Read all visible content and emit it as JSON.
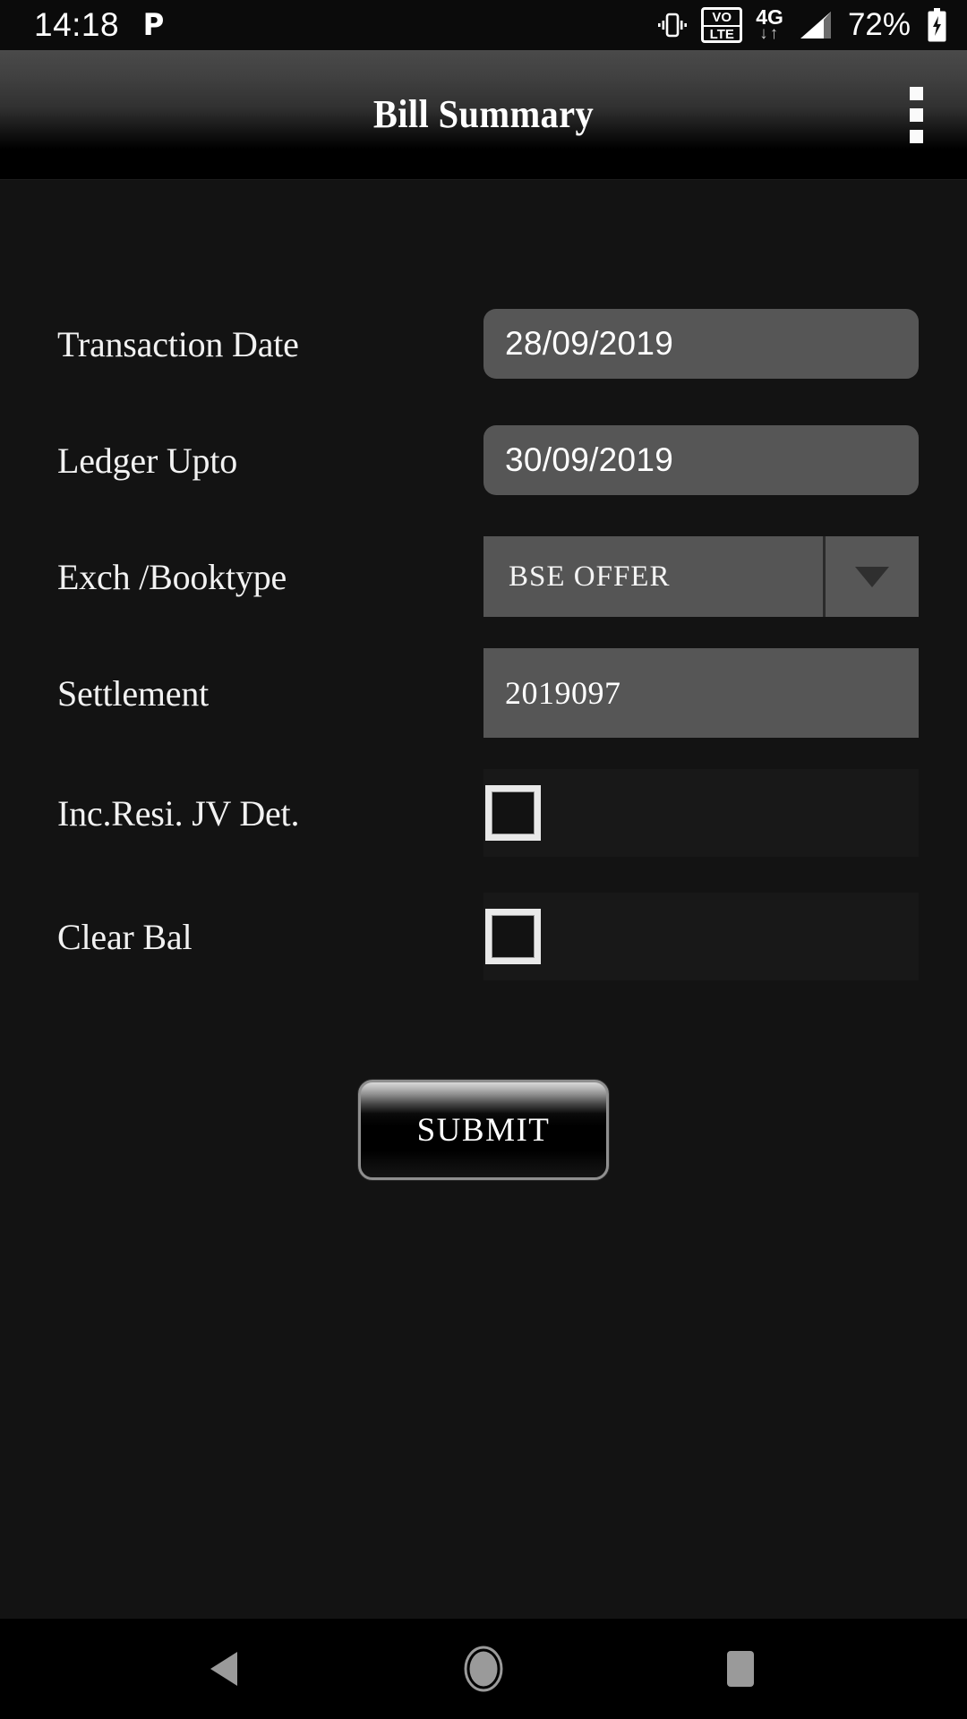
{
  "status_bar": {
    "clock": "14:18",
    "app_icon": "P",
    "icons": [
      "vibrate-icon",
      "volte-icon",
      "4g-icon",
      "signal-icon",
      "battery-charging-icon"
    ],
    "volte_top": "VO",
    "volte_bottom": "LTE",
    "network": "4G",
    "network_arrows": "↓↑",
    "battery_percent": "72%"
  },
  "app_bar": {
    "title": "Bill Summary",
    "overflow_label": "More options"
  },
  "form": {
    "rows": [
      {
        "label": "Transaction Date",
        "value": "28/09/2019",
        "type": "date"
      },
      {
        "label": "Ledger Upto",
        "value": "30/09/2019",
        "type": "date"
      },
      {
        "label": "Exch /Booktype",
        "value": "BSE  OFFER",
        "type": "spinner"
      },
      {
        "label": "Settlement",
        "value": "2019097",
        "type": "text"
      },
      {
        "label": "Inc.Resi. JV Det.",
        "value": "",
        "type": "checkbox",
        "checked": false
      },
      {
        "label": "Clear Bal",
        "value": "",
        "type": "checkbox",
        "checked": false
      }
    ]
  },
  "submit": {
    "label": "SUBMIT"
  },
  "nav_bar": {
    "back": "back-icon",
    "home": "home-icon",
    "recents": "recents-icon"
  },
  "colors": {
    "page_background": "#131313",
    "field_fill": "#565656",
    "spinner_fill": "#555555",
    "checkbox_band": "#181818",
    "text_primary": "#ffffff",
    "nav_icon": "#9a9a9a"
  }
}
